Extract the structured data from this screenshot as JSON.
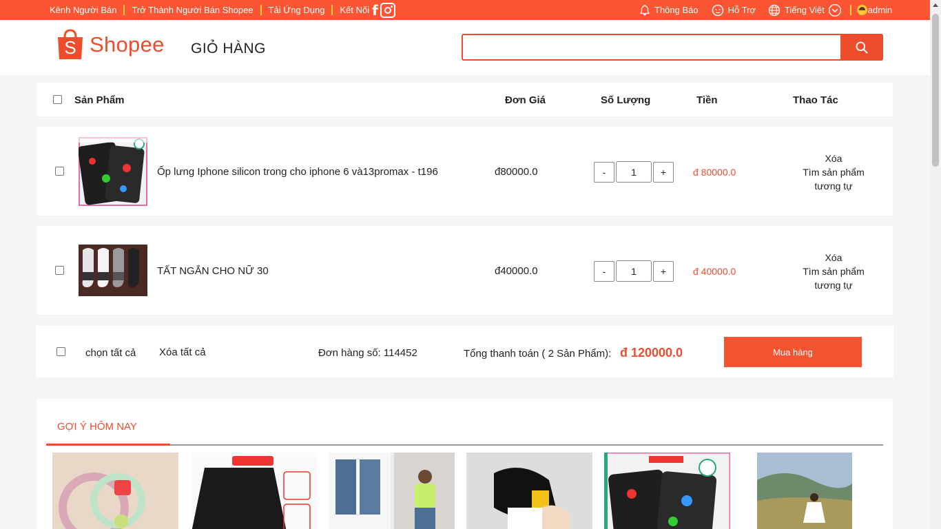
{
  "topbar": {
    "seller_channel": "Kênh Người Bán",
    "become_seller": "Trở Thành Người Bán Shopee",
    "download_app": "Tải Ứng Dụng",
    "connect": "Kết Nối",
    "notifications": "Thông Báo",
    "support": "Hỗ Trợ",
    "language": "Tiếng Việt",
    "username": "admin"
  },
  "header": {
    "logo_text": "Shopee",
    "page_title": "GIỎ HÀNG",
    "search_placeholder": ""
  },
  "table": {
    "columns": [
      "Sản Phẩm",
      "Đơn Giá",
      "Số Lượng",
      "Tiền",
      "Thao Tác"
    ]
  },
  "cart_items": [
    {
      "name": "Ốp lưng Iphone silicon trong cho iphone 6 và13promax - t196",
      "unit_price": "đ80000.0",
      "quantity": "1",
      "total": "đ 80000.0",
      "action_delete": "Xóa",
      "action_similar": "Tìm sản phẩm tương tự"
    },
    {
      "name": "TẤT NGẮN CHO NỮ 30",
      "unit_price": "đ40000.0",
      "quantity": "1",
      "total": "đ 40000.0",
      "action_delete": "Xóa",
      "action_similar": "Tìm sản phẩm tương tự"
    }
  ],
  "checkout": {
    "select_all": "chọn tất cả",
    "delete_all": "Xóa tất cả",
    "order_number": "Đơn hàng số: 114452",
    "total_label": "Tổng thanh toán ( 2 Sản Phẩm):",
    "total_amount": "đ 120000.0",
    "buy_button": "Mua hàng"
  },
  "suggestions": {
    "title": "GỢI Ý HÔM NAY"
  },
  "colors": {
    "brand": "#ee4d2d",
    "topbar": "#fb5533"
  }
}
